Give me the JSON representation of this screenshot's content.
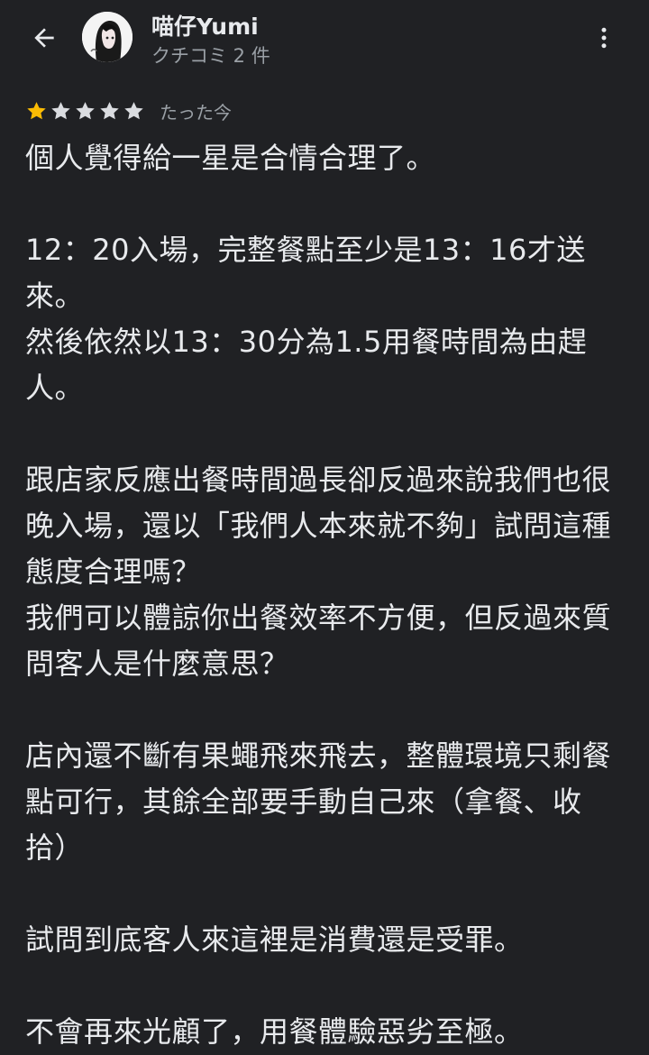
{
  "header": {
    "back_icon": "arrow-back-icon",
    "user_name": "喵仔Yumi",
    "review_count": "クチコミ 2 件",
    "more_icon": "more-vert-icon"
  },
  "review": {
    "rating": 1,
    "max_rating": 5,
    "star_filled_color": "#fbbc04",
    "star_empty_color": "#dadce0",
    "time": "たった今",
    "text": "個人覺得給一星是合情合理了。\n\n12：20入場，完整餐點至少是13：16才送來。\n然後依然以13：30分為1.5用餐時間為由趕人。\n\n跟店家反應出餐時間過長卻反過來說我們也很晚入場，還以「我們人本來就不夠」試問這種態度合理嗎？\n我們可以體諒你出餐效率不方便，但反過來質問客人是什麼意思？\n\n店內還不斷有果蠅飛來飛去，整體環境只剩餐點可行，其餘全部要手動自己來（拿餐、收拾）\n\n試問到底客人來這裡是消費還是受罪。\n\n不會再來光顧了，用餐體驗惡劣至極。"
  }
}
